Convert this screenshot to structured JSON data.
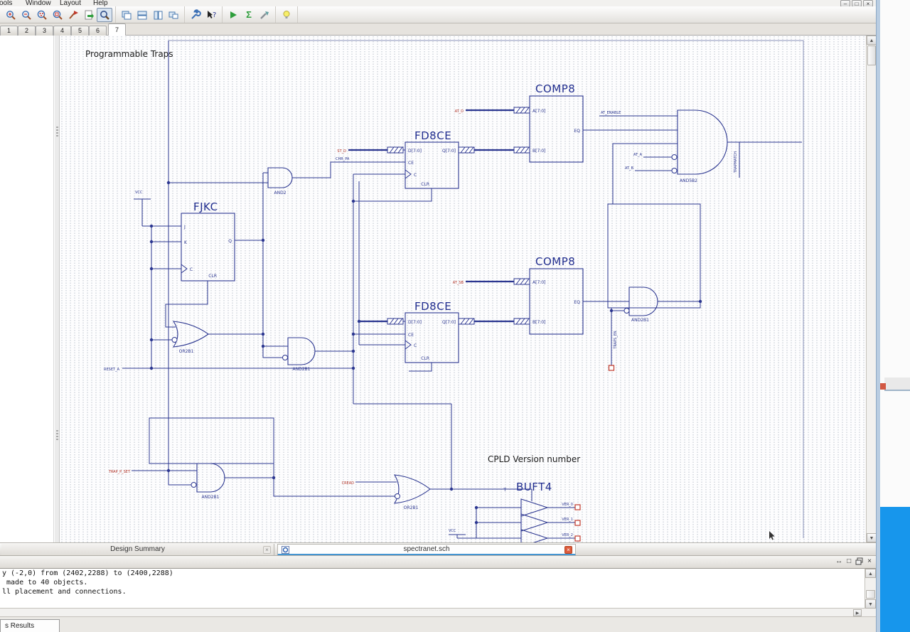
{
  "titlebar": {
    "menu": [
      "Tools",
      "Window",
      "Layout",
      "Help"
    ],
    "buttons": {
      "minimize": "–",
      "restore": "□",
      "close": "×"
    }
  },
  "toolbar": {
    "sigma": "Σ",
    "icon_names": [
      "zoom-in",
      "zoom-out",
      "zoom-window",
      "zoom-full",
      "zoom-prev",
      "export-doc",
      "select-zoom-pressed",
      "cascade-windows",
      "tile-horizontal",
      "tile-vertical",
      "arrange-windows",
      "options-wrench",
      "context-help",
      "run",
      "summary-sigma",
      "goto-tool",
      "lightbulb"
    ]
  },
  "doc_tabs": {
    "pages": [
      "1",
      "2",
      "3",
      "4",
      "5",
      "6",
      "7"
    ],
    "active_page": "7"
  },
  "icons": {
    "up": "▲",
    "down": "▼",
    "right": "▶",
    "close": "×",
    "dock": "↔",
    "float": "□"
  },
  "schematic": {
    "annotations": {
      "traps": "Programmable Traps",
      "cpld": "CPLD Version number"
    },
    "lib": {
      "comp8": {
        "title": "COMP8",
        "a": "A[7:0]",
        "b": "B[7:0]",
        "eq": "EQ"
      },
      "fd8ce": {
        "title": "FD8CE",
        "d": "D[7:0]",
        "ce": "CE",
        "c": "C",
        "clr": "CLR",
        "q": "Q[7:0]"
      },
      "fjkc": {
        "title": "FJKC",
        "j": "J",
        "k": "K",
        "c": "C",
        "clr": "CLR",
        "q": "Q"
      },
      "gates": {
        "and2": "AND2",
        "and2b1": "AND2B1",
        "or2b1": "OR2B1",
        "and5b2": "AND5B2",
        "buft4": "BUFT4"
      },
      "power": {
        "vcc": "VCC"
      }
    },
    "nets": {
      "t": "T",
      "at_d": "AT_D",
      "st_d": "ST_D",
      "chr_pa": "CHR_PA",
      "at_enable": "AT_ENABLE",
      "at_sb": "AT_SB",
      "reset": "RESET_A",
      "trap": "TRAP_P_SET",
      "cread": "CREAD",
      "and5_a": "AT_A",
      "and5_b": "AT_B",
      "vert_out": "TRAPMATCH",
      "vert_trap": "TRAPS_EN",
      "ver": [
        "VER_0",
        "VER_1",
        "VER_2"
      ]
    }
  },
  "sheet_tabs": {
    "design_summary": "Design Summary",
    "file": "spectranet.sch"
  },
  "console": {
    "lines": [
      "y (-2,0) from (2402,2288) to (2400,2288)",
      " made to 40 objects.",
      "ll placement and connections."
    ]
  },
  "status": {
    "results_tab": "s Results"
  }
}
